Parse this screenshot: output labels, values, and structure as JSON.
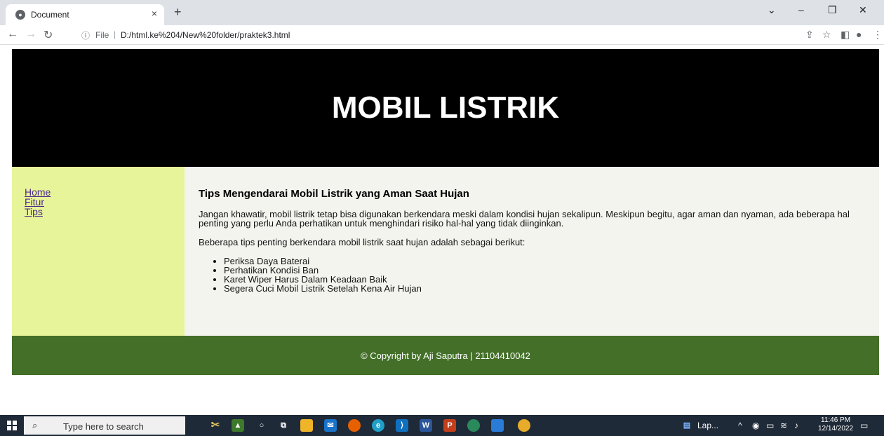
{
  "browser": {
    "tab_title": "Document",
    "tab_close": "×",
    "new_tab": "+",
    "url_file_label": "File",
    "url_separator": "|",
    "url": "D:/html.ke%204/New%20folder/praktek3.html",
    "window_controls": [
      "minimize-icon",
      "restore-icon",
      "close-icon"
    ]
  },
  "page": {
    "header_title": "MOBIL LISTRIK",
    "nav": [
      "Home",
      "Fitur",
      "Tips"
    ],
    "article": {
      "heading": "Tips Mengendarai Mobil Listrik yang Aman Saat Hujan",
      "paragraph1": "Jangan khawatir, mobil listrik tetap bisa digunakan berkendara meski dalam kondisi hujan sekalipun. Meskipun begitu, agar aman dan nyaman, ada beberapa hal penting yang perlu Anda perhatikan untuk menghindari risiko hal-hal yang tidak diinginkan.",
      "paragraph2": "Beberapa tips penting berkendara mobil listrik saat hujan adalah sebagai berikut:",
      "tips": [
        "Periksa Daya Baterai",
        "Perhatikan Kondisi Ban",
        "Karet Wiper Harus Dalam Keadaan Baik",
        "Segera Cuci Mobil Listrik Setelah Kena Air Hujan"
      ]
    },
    "footer": "© Copyright by Aji Saputra | 21104410042",
    "colors": {
      "header_bg": "#000000",
      "sidebar_bg": "#e8f49a",
      "content_bg": "#f4f4ef",
      "footer_bg": "#436f28"
    }
  },
  "taskbar": {
    "search_placeholder": "Type here to search",
    "pinned_app_label": "Lap...",
    "time": "11:46 PM",
    "date": "12/14/2022"
  }
}
